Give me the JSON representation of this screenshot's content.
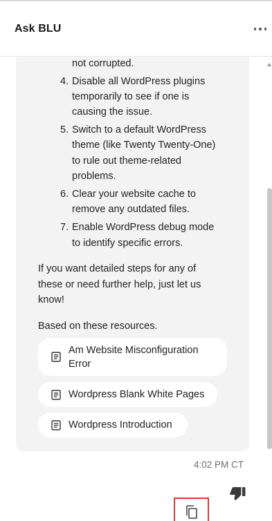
{
  "header": {
    "title": "Ask BLU",
    "more_icon": "more-horizontal-icon"
  },
  "message": {
    "continuation": "not corrupted.",
    "steps": [
      {
        "num": "4.",
        "lines": [
          "Disable all WordPress plugins",
          "temporarily to see if one is",
          "causing the issue."
        ]
      },
      {
        "num": "5.",
        "lines": [
          "Switch to a default WordPress",
          "theme (like Twenty Twenty-One)",
          "to rule out theme-related",
          "problems."
        ]
      },
      {
        "num": "6.",
        "lines": [
          "Clear your website cache to",
          "remove any outdated files."
        ]
      },
      {
        "num": "7.",
        "lines": [
          "Enable WordPress debug mode",
          "to identify specific errors."
        ]
      }
    ],
    "followup_lines": [
      "If you want detailed steps for any of",
      "these or need further help, just let us",
      "know!"
    ],
    "resources_heading": "Based on these resources.",
    "resources": [
      {
        "lines": [
          "Am Website Misconfiguration",
          "Error"
        ],
        "icon": "article-icon"
      },
      {
        "lines": [
          "Wordpress Blank White Pages"
        ],
        "icon": "article-icon"
      },
      {
        "lines": [
          "Wordpress Introduction"
        ],
        "icon": "article-icon"
      }
    ],
    "timestamp": "4:02 PM CT"
  },
  "actions": {
    "copy_icon": "copy-icon",
    "dislike_icon": "thumbs-down-icon"
  }
}
